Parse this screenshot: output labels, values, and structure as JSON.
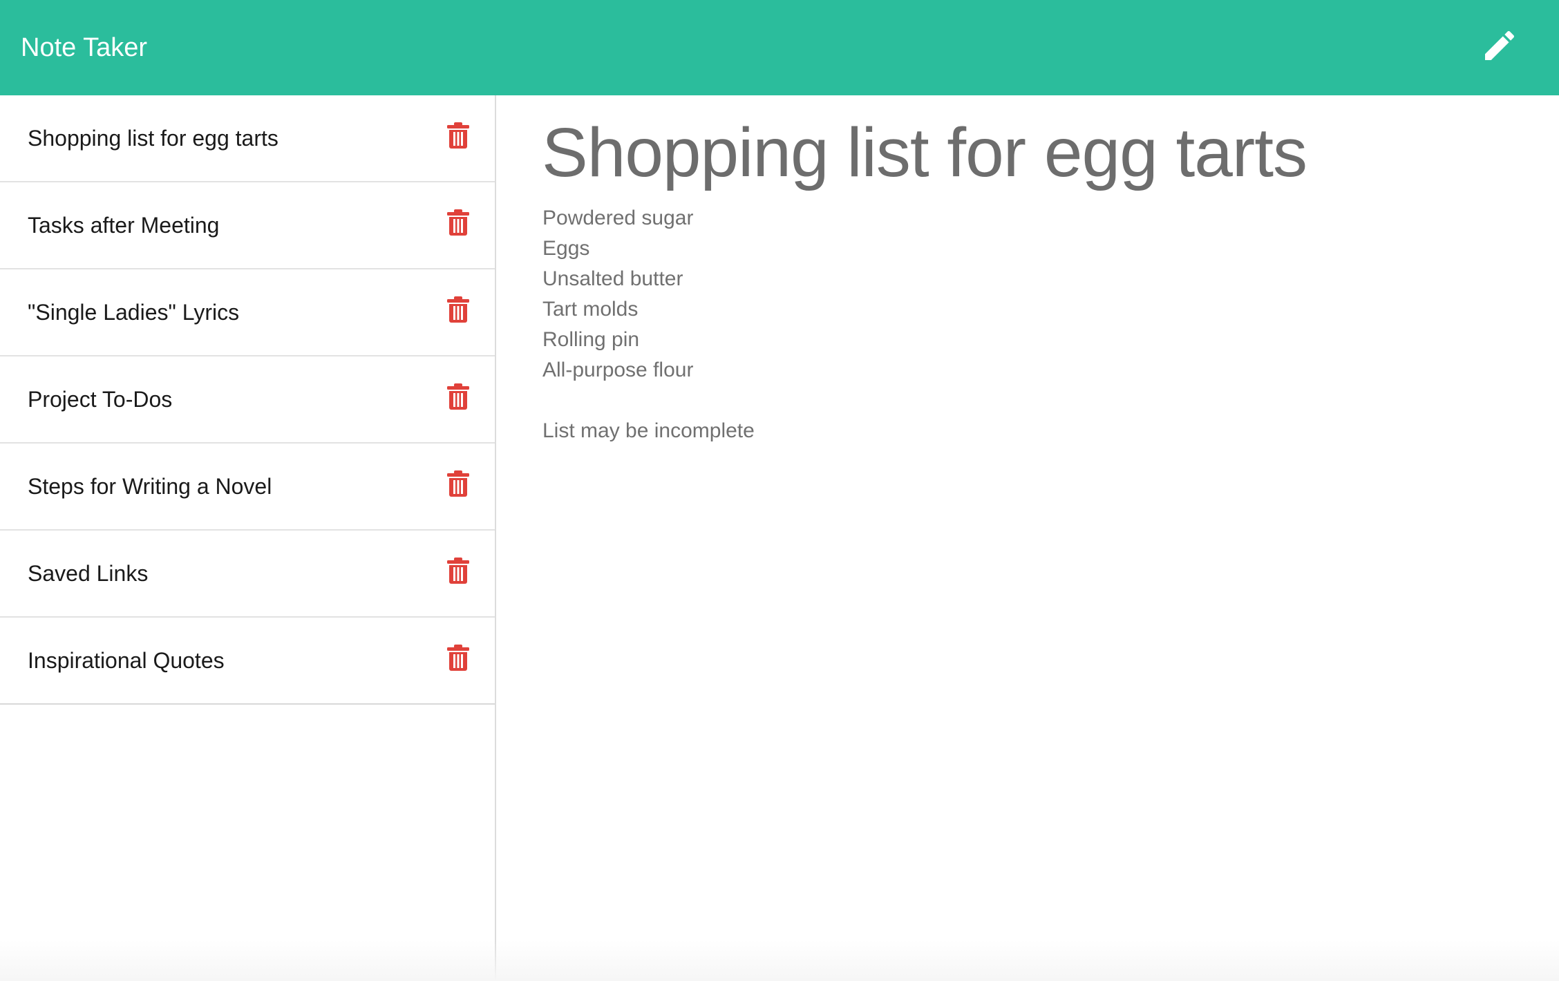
{
  "app": {
    "title": "Note Taker",
    "brand_color": "#2bbd9c",
    "new_note_icon": "pencil-icon"
  },
  "notes": [
    {
      "title": "Shopping list for egg tarts",
      "delete_icon": "trash-icon"
    },
    {
      "title": "Tasks after Meeting",
      "delete_icon": "trash-icon"
    },
    {
      "title": "\"Single Ladies\" Lyrics",
      "delete_icon": "trash-icon"
    },
    {
      "title": "Project To-Dos",
      "delete_icon": "trash-icon"
    },
    {
      "title": "Steps for Writing a Novel",
      "delete_icon": "trash-icon"
    },
    {
      "title": "Saved Links",
      "delete_icon": "trash-icon"
    },
    {
      "title": "Inspirational Quotes",
      "delete_icon": "trash-icon"
    }
  ],
  "active_note": {
    "title": "Shopping list for egg tarts",
    "body_lines": [
      "Powdered sugar",
      "Eggs",
      "Unsalted butter",
      "Tart molds",
      "Rolling pin",
      "All-purpose flour",
      "",
      "List may be incomplete"
    ]
  },
  "colors": {
    "delete_icon": "#e0413a",
    "heading_text": "#6d6d6d"
  }
}
